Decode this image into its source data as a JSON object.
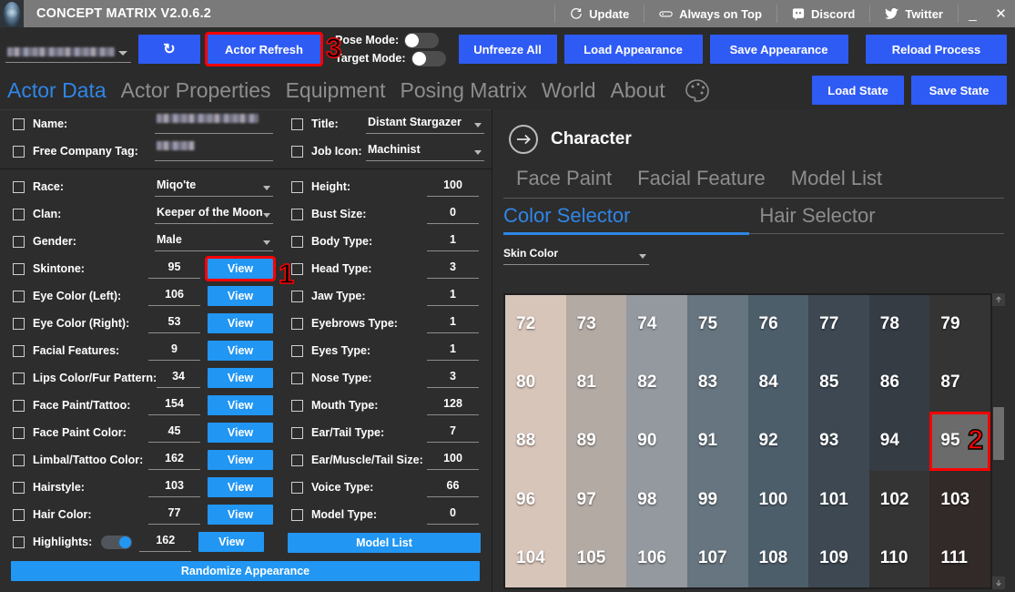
{
  "titlebar": {
    "app_title": "CONCEPT MATRIX V2.0.6.2",
    "logo_icon": "hooded-figure-logo",
    "buttons": [
      {
        "label": "Update",
        "icon": "refresh-clock-icon"
      },
      {
        "label": "Always on Top",
        "icon": "pin-window-icon"
      },
      {
        "label": "Discord",
        "icon": "discord-icon"
      },
      {
        "label": "Twitter",
        "icon": "twitter-bird-icon"
      }
    ],
    "minimize": "_",
    "close": "✕"
  },
  "toolbar": {
    "actor_select_value": "",
    "refresh_icon_label": "↻",
    "actor_refresh_label": "Actor Refresh",
    "pose_mode_label": "Pose Mode:",
    "pose_mode_on": false,
    "target_mode_label": "Target Mode:",
    "target_mode_on": false,
    "unfreeze_all_label": "Unfreeze All",
    "load_appearance_label": "Load Appearance",
    "save_appearance_label": "Save Appearance",
    "reload_process_label": "Reload Process"
  },
  "nav": {
    "tabs": [
      {
        "label": "Actor Data",
        "active": true
      },
      {
        "label": "Actor Properties",
        "active": false
      },
      {
        "label": "Equipment",
        "active": false
      },
      {
        "label": "Posing Matrix",
        "active": false
      },
      {
        "label": "World",
        "active": false
      },
      {
        "label": "About",
        "active": false
      }
    ],
    "palette_icon": "palette-icon",
    "load_state_label": "Load State",
    "save_state_label": "Save State"
  },
  "left_panel": {
    "identity": [
      {
        "label": "Name:",
        "value": "",
        "type": "blurred-text"
      },
      {
        "label": "Free Company Tag:",
        "value": "",
        "type": "blurred-text"
      }
    ],
    "column_a": [
      {
        "label": "Race:",
        "value": "Miqo'te",
        "type": "dropdown"
      },
      {
        "label": "Clan:",
        "value": "Keeper of the Moon",
        "type": "dropdown"
      },
      {
        "label": "Gender:",
        "value": "Male",
        "type": "dropdown"
      },
      {
        "label": "Skintone:",
        "value": "95",
        "type": "number-view",
        "button": "View",
        "highlighted": true
      },
      {
        "label": "Eye Color (Left):",
        "value": "106",
        "type": "number-view",
        "button": "View"
      },
      {
        "label": "Eye Color (Right):",
        "value": "53",
        "type": "number-view",
        "button": "View"
      },
      {
        "label": "Facial Features:",
        "value": "9",
        "type": "number-view",
        "button": "View"
      },
      {
        "label": "Lips Color/Fur Pattern:",
        "value": "34",
        "type": "number-view",
        "button": "View"
      },
      {
        "label": "Face Paint/Tattoo:",
        "value": "154",
        "type": "number-view",
        "button": "View"
      },
      {
        "label": "Face Paint Color:",
        "value": "45",
        "type": "number-view",
        "button": "View"
      },
      {
        "label": "Limbal/Tattoo Color:",
        "value": "162",
        "type": "number-view",
        "button": "View"
      },
      {
        "label": "Hairstyle:",
        "value": "103",
        "type": "number-view",
        "button": "View"
      },
      {
        "label": "Hair Color:",
        "value": "77",
        "type": "number-view",
        "button": "View"
      },
      {
        "label": "Highlights:",
        "value": "162",
        "type": "toggle-number-view",
        "button": "View",
        "toggle_on": true
      }
    ],
    "randomize_label": "Randomize Appearance",
    "column_b_top": [
      {
        "label": "Title:",
        "value": "Distant Stargazer",
        "type": "dropdown"
      },
      {
        "label": "Job Icon:",
        "value": "Machinist",
        "type": "dropdown"
      }
    ],
    "column_b": [
      {
        "label": "Height:",
        "value": "100"
      },
      {
        "label": "Bust Size:",
        "value": "0"
      },
      {
        "label": "Body Type:",
        "value": "1"
      },
      {
        "label": "Head Type:",
        "value": "3"
      },
      {
        "label": "Jaw Type:",
        "value": "1"
      },
      {
        "label": "Eyebrows Type:",
        "value": "1"
      },
      {
        "label": "Eyes Type:",
        "value": "1"
      },
      {
        "label": "Nose Type:",
        "value": "3"
      },
      {
        "label": "Mouth Type:",
        "value": "128"
      },
      {
        "label": "Ear/Tail Type:",
        "value": "7"
      },
      {
        "label": "Ear/Muscle/Tail Size:",
        "value": "100"
      },
      {
        "label": "Voice Type:",
        "value": "66"
      },
      {
        "label": "Model Type:",
        "value": "0"
      }
    ],
    "model_list_label": "Model List"
  },
  "right_panel": {
    "back_icon": "arrow-right-circle-icon",
    "header_title": "Character",
    "tabs_row1": [
      {
        "label": "Face Paint",
        "active": false
      },
      {
        "label": "Facial Feature",
        "active": false
      },
      {
        "label": "Model List",
        "active": false
      }
    ],
    "tabs_row2": [
      {
        "label": "Color Selector",
        "active": true
      },
      {
        "label": "Hair Selector",
        "active": false
      }
    ],
    "category_select": "Skin Color",
    "scrollbar": {
      "up_arrow": "↑",
      "down_arrow": "↓"
    },
    "swatches": [
      {
        "id": "72",
        "color": "#d8c5ba",
        "selected": false
      },
      {
        "id": "73",
        "color": "#b3aaa4",
        "selected": false
      },
      {
        "id": "74",
        "color": "#93999f",
        "selected": false
      },
      {
        "id": "75",
        "color": "#66757f",
        "selected": false
      },
      {
        "id": "76",
        "color": "#4d5e6b",
        "selected": false
      },
      {
        "id": "77",
        "color": "#3d4852",
        "selected": false
      },
      {
        "id": "78",
        "color": "#363c44",
        "selected": false
      },
      {
        "id": "79",
        "color": "#343434",
        "selected": false
      },
      {
        "id": "80",
        "color": "#d8c5ba",
        "selected": false
      },
      {
        "id": "81",
        "color": "#b3aaa4",
        "selected": false
      },
      {
        "id": "82",
        "color": "#93999f",
        "selected": false
      },
      {
        "id": "83",
        "color": "#66757f",
        "selected": false
      },
      {
        "id": "84",
        "color": "#4d5e6b",
        "selected": false
      },
      {
        "id": "85",
        "color": "#3d4852",
        "selected": false
      },
      {
        "id": "86",
        "color": "#363c44",
        "selected": false
      },
      {
        "id": "87",
        "color": "#343434",
        "selected": false
      },
      {
        "id": "88",
        "color": "#d8c5ba",
        "selected": false
      },
      {
        "id": "89",
        "color": "#b3aaa4",
        "selected": false
      },
      {
        "id": "90",
        "color": "#93999f",
        "selected": false
      },
      {
        "id": "91",
        "color": "#66757f",
        "selected": false
      },
      {
        "id": "92",
        "color": "#4d5e6b",
        "selected": false
      },
      {
        "id": "93",
        "color": "#3d4852",
        "selected": false
      },
      {
        "id": "94",
        "color": "#363c44",
        "selected": false
      },
      {
        "id": "95",
        "color": "#6b6b6b",
        "selected": true
      },
      {
        "id": "96",
        "color": "#d8c5ba",
        "selected": false
      },
      {
        "id": "97",
        "color": "#b3aaa4",
        "selected": false
      },
      {
        "id": "98",
        "color": "#93999f",
        "selected": false
      },
      {
        "id": "99",
        "color": "#66757f",
        "selected": false
      },
      {
        "id": "100",
        "color": "#4d5e6b",
        "selected": false
      },
      {
        "id": "101",
        "color": "#3d4852",
        "selected": false
      },
      {
        "id": "102",
        "color": "#343434",
        "selected": false
      },
      {
        "id": "103",
        "color": "#322a28",
        "selected": false
      },
      {
        "id": "104",
        "color": "#d8c5ba",
        "selected": false
      },
      {
        "id": "105",
        "color": "#b3aaa4",
        "selected": false
      },
      {
        "id": "106",
        "color": "#93999f",
        "selected": false
      },
      {
        "id": "107",
        "color": "#66757f",
        "selected": false
      },
      {
        "id": "108",
        "color": "#4d5e6b",
        "selected": false
      },
      {
        "id": "109",
        "color": "#3d4852",
        "selected": false
      },
      {
        "id": "110",
        "color": "#343434",
        "selected": false
      },
      {
        "id": "111",
        "color": "#322a28",
        "selected": false
      }
    ]
  },
  "annotations": [
    {
      "label": "1",
      "target": "skintone-view-button"
    },
    {
      "label": "2",
      "target": "swatch-95"
    },
    {
      "label": "3",
      "target": "actor-refresh-button"
    }
  ],
  "colors": {
    "accent_blue": "#2196f3",
    "primary_blue": "#2f5bf5",
    "tab_active": "#2f86e8",
    "highlight_red": "#fe0000",
    "panel_bg": "#2d2d2d",
    "titlebar_bg": "#7a7a7a"
  }
}
